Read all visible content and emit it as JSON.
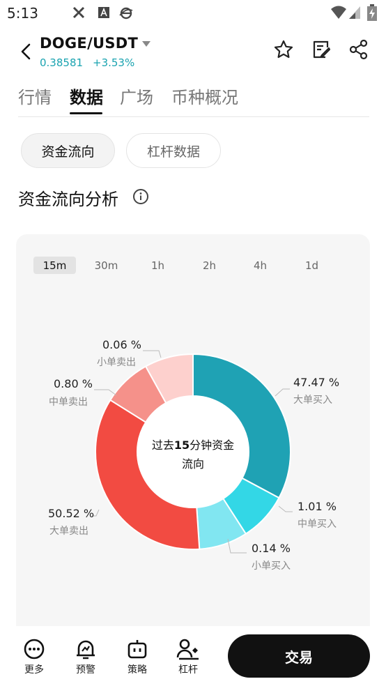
{
  "status_bar": {
    "time": "5:13"
  },
  "header": {
    "pair": "DOGE/USDT",
    "price": "0.38581",
    "change": "+3.53%"
  },
  "tabs": [
    {
      "label": "行情"
    },
    {
      "label": "数据"
    },
    {
      "label": "广场"
    },
    {
      "label": "币种概况"
    }
  ],
  "subtabs": {
    "active": "资金流向",
    "inactive": "杠杆数据"
  },
  "section": {
    "title": "资金流向分析"
  },
  "timeframes": [
    "15m",
    "30m",
    "1h",
    "2h",
    "4h",
    "1d"
  ],
  "chart": {
    "center_prefix": "过去",
    "center_num": "15",
    "center_suffix": "分钟资金",
    "center_line2": "流向",
    "colors": {
      "big_buy": "#1fa2b4",
      "mid_buy": "#33d7e6",
      "small_buy": "#81e6f1",
      "big_sell": "#f24b42",
      "mid_sell": "#f5918a",
      "small_sell": "#fdd0cd"
    }
  },
  "chart_data": {
    "type": "pie",
    "slices": [
      {
        "label": "大单买入",
        "value": 47.47,
        "text": "47.47 %"
      },
      {
        "label": "中单买入",
        "value": 1.01,
        "text": "1.01 %"
      },
      {
        "label": "小单买入",
        "value": 0.14,
        "text": "0.14 %"
      },
      {
        "label": "大单卖出",
        "value": 50.52,
        "text": "50.52 %"
      },
      {
        "label": "中单卖出",
        "value": 0.8,
        "text": "0.80 %"
      },
      {
        "label": "小单卖出",
        "value": 0.06,
        "text": "0.06 %"
      }
    ]
  },
  "bottom_nav": {
    "more": "更多",
    "alert": "预警",
    "strategy": "策略",
    "leverage": "杠杆",
    "trade": "交易"
  }
}
